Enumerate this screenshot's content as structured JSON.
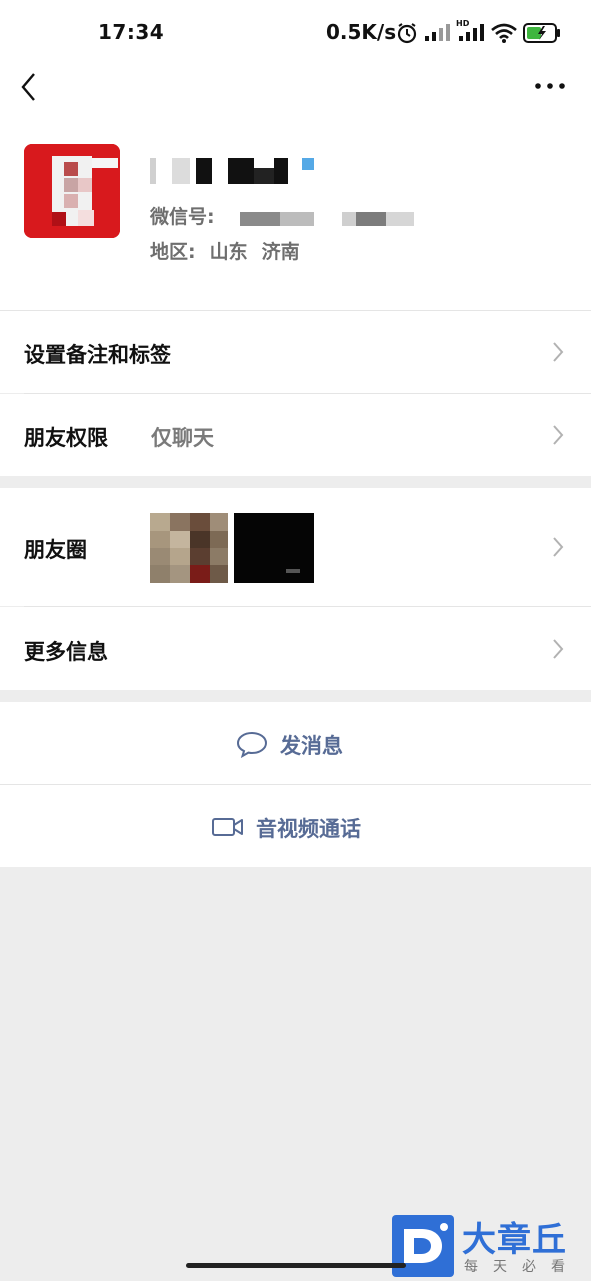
{
  "status_bar": {
    "time": "17:34",
    "network_speed": "0.5K/s",
    "icons": [
      "alarm-icon",
      "signal-icon",
      "hd-signal-icon",
      "wifi-icon",
      "battery-charging-icon"
    ]
  },
  "nav": {
    "back_icon": "chevron-left-icon",
    "more_icon": "more-dots-icon"
  },
  "profile": {
    "wechat_id_label": "微信号:",
    "region_label": "地区:",
    "region_province": "山东",
    "region_city": "济南"
  },
  "rows": {
    "remark_tags": "设置备注和标签",
    "friend_permission_label": "朋友权限",
    "friend_permission_value": "仅聊天",
    "moments": "朋友圈",
    "more_info": "更多信息"
  },
  "actions": {
    "send_message": "发消息",
    "av_call": "音视频通话"
  },
  "watermark": {
    "title": "大章丘",
    "subtitle": "每天必看"
  },
  "colors": {
    "link_blue": "#576b95",
    "background_gray": "#ededed",
    "avatar_red": "#d8191d",
    "watermark_blue": "#2f6fd6"
  }
}
